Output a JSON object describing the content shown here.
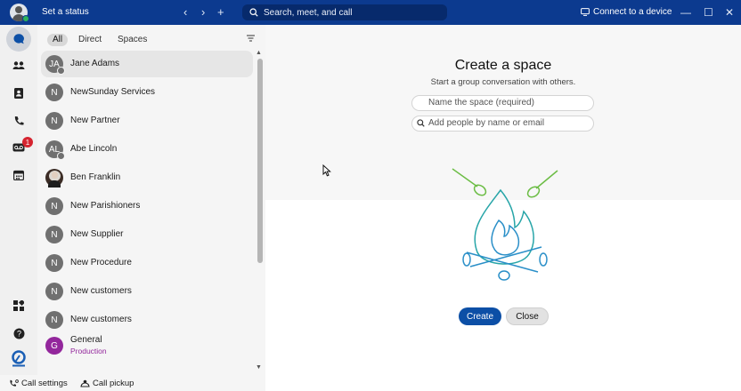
{
  "titlebar": {
    "set_status": "Set a status",
    "search_placeholder": "Search, meet, and call",
    "connect_device": "Connect to a device",
    "nav_back": "‹",
    "nav_forward": "›",
    "nav_new": "+",
    "win_minimize": "—",
    "win_maximize": "☐",
    "win_close": "✕",
    "bg_color": "#0c3a8f"
  },
  "rail": {
    "items": [
      {
        "name": "messaging",
        "icon": "chat-bubble-icon",
        "active": true
      },
      {
        "name": "teams",
        "icon": "people-icon"
      },
      {
        "name": "contacts",
        "icon": "contacts-icon"
      },
      {
        "name": "calling",
        "icon": "phone-icon"
      },
      {
        "name": "voicemail",
        "icon": "voicemail-icon",
        "badge": "1"
      },
      {
        "name": "meetings",
        "icon": "calendar-icon"
      },
      {
        "name": "apps",
        "icon": "apps-grid-icon"
      },
      {
        "name": "help",
        "icon": "help-icon"
      },
      {
        "name": "brand",
        "icon": "crossroad-logo-icon"
      }
    ]
  },
  "list": {
    "filters": [
      "All",
      "Direct",
      "Spaces"
    ],
    "active_filter": "All",
    "contacts": [
      {
        "initials": "JA",
        "name": "Jane Adams",
        "selected": true,
        "status_dot": true
      },
      {
        "initials": "N",
        "name": "NewSunday Services"
      },
      {
        "initials": "N",
        "name": "New Partner"
      },
      {
        "initials": "AL",
        "name": "Abe Lincoln",
        "status_dot": true
      },
      {
        "initials": "",
        "name": "Ben Franklin",
        "photo": true
      },
      {
        "initials": "N",
        "name": "New Parishioners"
      },
      {
        "initials": "N",
        "name": "New Supplier"
      },
      {
        "initials": "N",
        "name": "New Procedure"
      },
      {
        "initials": "N",
        "name": "New customers"
      },
      {
        "initials": "N",
        "name": "New customers"
      },
      {
        "initials": "G",
        "name": "General",
        "sub": "Production",
        "color": "#93279c"
      }
    ]
  },
  "bottom": {
    "call_settings": "Call settings",
    "call_pickup": "Call pickup"
  },
  "main": {
    "title": "Create a space",
    "subtitle": "Start a group conversation with others.",
    "name_placeholder": "Name the space (required)",
    "people_placeholder": "Add people by name or email",
    "create_label": "Create",
    "close_label": "Close",
    "accent_color": "#0c4fa6"
  }
}
